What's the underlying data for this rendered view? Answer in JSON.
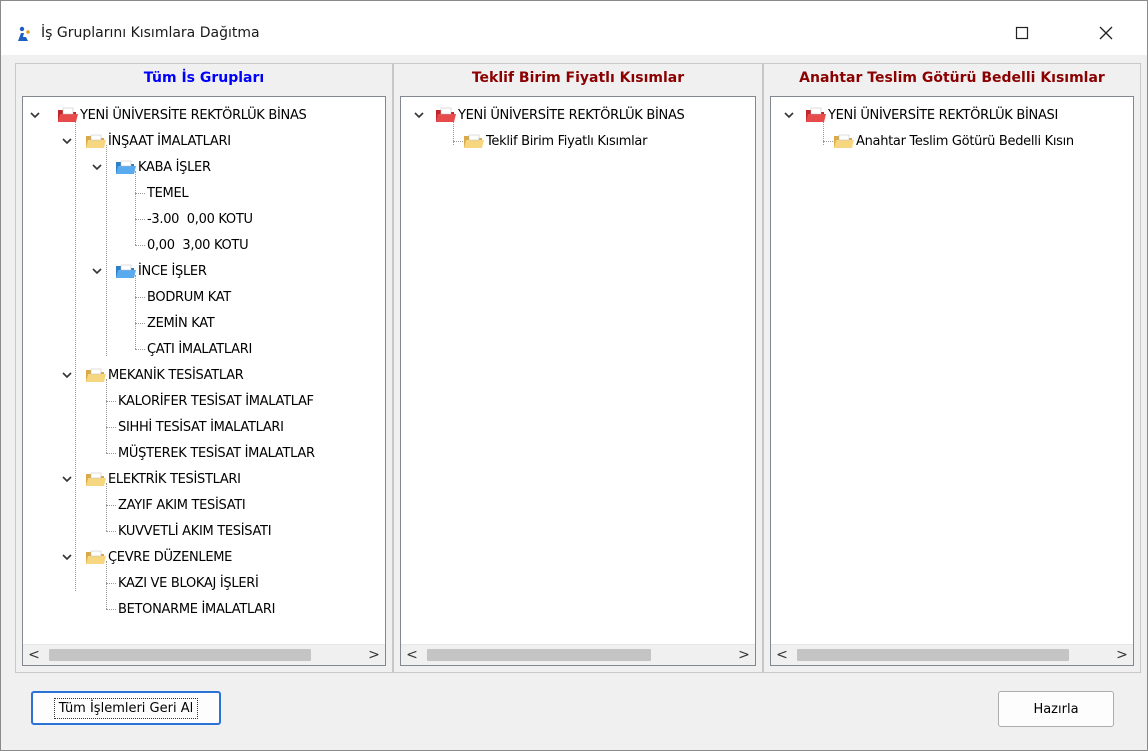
{
  "window": {
    "title": "İş Gruplarını Kısımlara Dağıtma"
  },
  "panels": {
    "left": {
      "header": "Tüm İs Grupları",
      "header_color": "#0000ff"
    },
    "middle": {
      "header": "Teklif Birim Fiyatlı Kısımlar",
      "header_color": "#8b0000",
      "root": "YENİ ÜNİVERSİTE REKTÖRLÜK BİNAS",
      "child": "Teklif Birim Fiyatlı Kısımlar"
    },
    "right": {
      "header": "Anahtar Teslim Götürü Bedelli Kısımlar",
      "header_color": "#8b0000",
      "root": "YENİ ÜNİVERSİTE REKTÖRLÜK BİNASI",
      "child": "Anahtar Teslim Götürü Bedelli Kısın"
    }
  },
  "tree_left": {
    "root": "YENİ ÜNİVERSİTE REKTÖRLÜK BİNAS",
    "insaat": "İNŞAAT İMALATLARI",
    "kaba": "KABA İŞLER",
    "temel": "TEMEL",
    "kot1": "-3.00  0,00 KOTU",
    "kot2": "0,00  3,00 KOTU",
    "ince": "İNCE İŞLER",
    "bodrum": "BODRUM KAT",
    "zemin": "ZEMİN KAT",
    "cati": "ÇATI İMALATLARI",
    "mekanik": "MEKANİK TESİSATLAR",
    "kalorifer": "KALORİFER TESİSAT İMALATLAF",
    "sihhi": "SIHHİ TESİSAT İMALATLARI",
    "musterek": "MÜŞTEREK TESİSAT İMALATLAR",
    "elektrik": "ELEKTRİK TESİSTLARI",
    "zayif": "ZAYIF AKIM TESİSATI",
    "kuvvetli": "KUVVETLİ AKIM TESİSATI",
    "cevre": "ÇEVRE DÜZENLEME",
    "kazi": "KAZI VE BLOKAJ İŞLERİ",
    "betonarme": "BETONARME İMALATLARI"
  },
  "buttons": {
    "geri_al": "Tüm İşlemleri Geri Al",
    "hazirla": "Hazırla"
  },
  "scroll": {
    "left_arrow": "<",
    "right_arrow": ">"
  },
  "icons": {
    "root_folder": "red-folder-icon",
    "group_folder": "yellow-folder-icon",
    "sub_folder": "blue-folder-icon"
  }
}
